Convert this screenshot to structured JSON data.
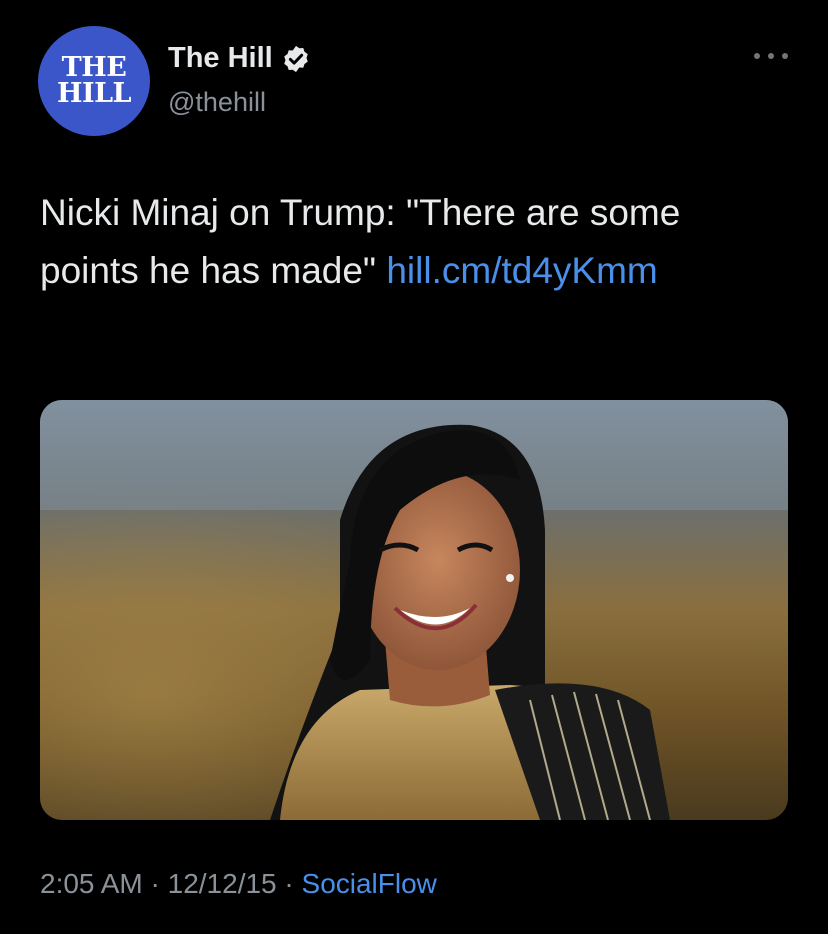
{
  "author": {
    "avatar_line1": "THE",
    "avatar_line2": "HILL",
    "display_name": "The Hill",
    "handle": "@thehill",
    "verified": true
  },
  "tweet": {
    "text": "Nicki Minaj on Trump: \"There are some points he has made\"",
    "link_text": "hill.cm/td4yKmm"
  },
  "media": {
    "description_icon": "photo"
  },
  "meta": {
    "time": "2:05 AM",
    "separator": "·",
    "date": "12/12/15",
    "source": "SocialFlow"
  },
  "colors": {
    "background": "#000000",
    "link": "#4a8fe8",
    "avatar": "#3a56c8",
    "secondary_text": "#8b9198"
  }
}
